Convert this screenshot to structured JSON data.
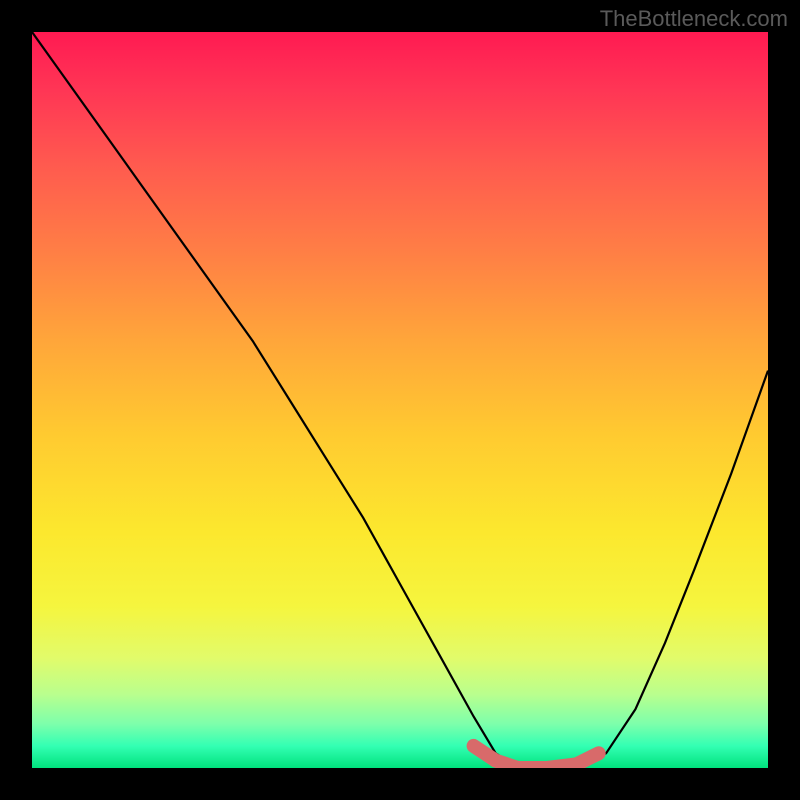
{
  "watermark": "TheBottleneck.com",
  "chart_data": {
    "type": "line",
    "title": "",
    "xlabel": "",
    "ylabel": "",
    "x_range": [
      0,
      100
    ],
    "y_range": [
      0,
      100
    ],
    "series": [
      {
        "name": "bottleneck-curve",
        "color": "#000000",
        "x": [
          0,
          5,
          10,
          15,
          20,
          25,
          30,
          35,
          40,
          45,
          50,
          55,
          60,
          63,
          66,
          70,
          74,
          78,
          82,
          86,
          90,
          95,
          100
        ],
        "y": [
          100,
          93,
          86,
          79,
          72,
          65,
          58,
          50,
          42,
          34,
          25,
          16,
          7,
          2,
          0,
          0,
          0,
          2,
          8,
          17,
          27,
          40,
          54
        ]
      },
      {
        "name": "optimal-range",
        "color": "#d86a6a",
        "x": [
          60,
          63,
          66,
          70,
          74,
          77
        ],
        "y": [
          3,
          1,
          0,
          0,
          0.5,
          2
        ]
      }
    ],
    "gradient_stops": [
      {
        "pos": 0.0,
        "color": "#ff1a52"
      },
      {
        "pos": 0.3,
        "color": "#ff7f45"
      },
      {
        "pos": 0.68,
        "color": "#fce82e"
      },
      {
        "pos": 0.9,
        "color": "#b9ff8e"
      },
      {
        "pos": 1.0,
        "color": "#00e27d"
      }
    ]
  }
}
